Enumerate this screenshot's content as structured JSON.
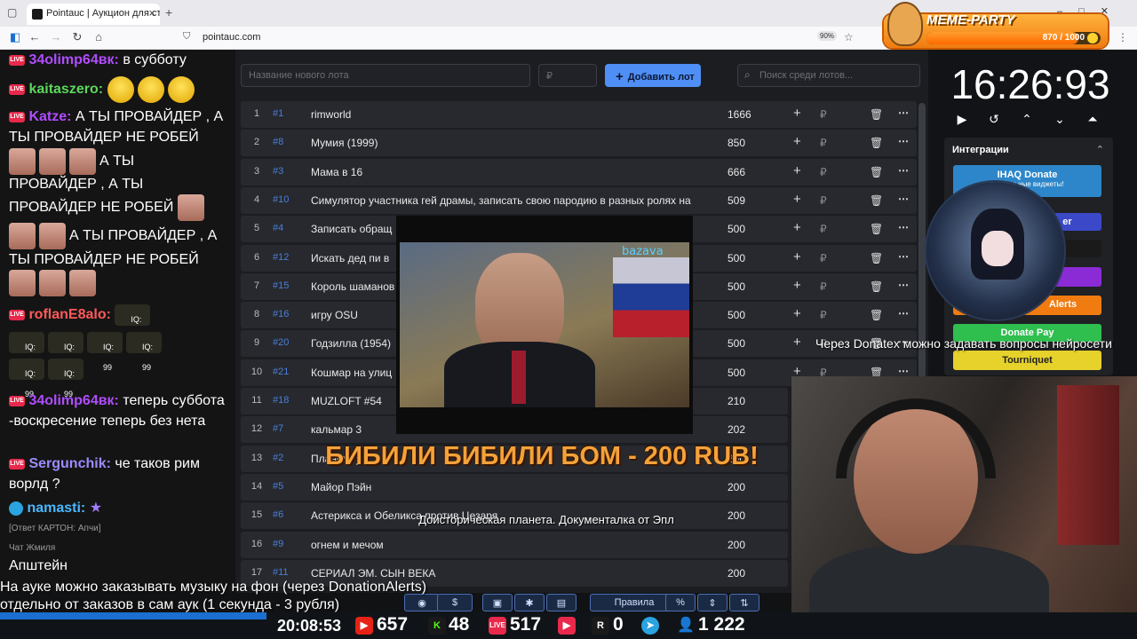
{
  "browser": {
    "tab_title": "Pointauc | Аукцион для стрим",
    "url": "pointauc.com",
    "zoom": "90%"
  },
  "meme": {
    "title": "MEME-PARTY",
    "score": "870 / 1000",
    "progress": 0.87
  },
  "chat": {
    "m1_nick": "34olimp64вк:",
    "m1_text": "в субботу",
    "m2_nick": "kaitaszero:",
    "m3_nick": "Katze:",
    "m3_text": "А ТЫ ПРОВАЙДЕР , А ТЫ ПРОВАЙДЕР НЕ РОБЕЙ",
    "m3_text2": "А ТЫ",
    "m3_text3": "ПРОВАЙДЕР , А ТЫ",
    "m3_text4": "ПРОВАЙДЕР НЕ РОБЕЙ",
    "m3_text5": "А ТЫ ПРОВАЙДЕР , А ТЫ ПРОВАЙДЕР НЕ РОБЕЙ",
    "m4_nick": "roflanE8alo:",
    "iq": "IQ: 99",
    "m5_nick": "34olimp64вк:",
    "m5_text": "теперь суббота -воскресение теперь без нета",
    "m6_nick": "Sergunchik:",
    "m6_text": "че таков рим ворлд ?",
    "m7_nick": "namasti:",
    "m7_star": "★",
    "m7_reply": "[Ответ КАРТОН: Апчи]",
    "m8_head": "Чат Жмиля",
    "m8_text": "Апштейн"
  },
  "auction": {
    "new_lot_placeholder": "Название нового лота",
    "amount_placeholder": "₽",
    "add_label": "Добавить лот",
    "search_placeholder": "Поиск среди лотов...",
    "rows": [
      {
        "i": "1",
        "id": "#1",
        "name": "rimworld",
        "amount": "1666"
      },
      {
        "i": "2",
        "id": "#8",
        "name": "Мумия (1999)",
        "amount": "850"
      },
      {
        "i": "3",
        "id": "#3",
        "name": "Мама в 16",
        "amount": "666"
      },
      {
        "i": "4",
        "id": "#10",
        "name": "Симулятор участника гей драмы, записать свою пародию в разных ролях на",
        "amount": "509"
      },
      {
        "i": "5",
        "id": "#4",
        "name": "Записать обращ",
        "amount": "500"
      },
      {
        "i": "6",
        "id": "#12",
        "name": "Искать дед пи в",
        "amount": "500"
      },
      {
        "i": "7",
        "id": "#15",
        "name": "Король шаманов",
        "amount": "500"
      },
      {
        "i": "8",
        "id": "#16",
        "name": "игру OSU",
        "amount": "500"
      },
      {
        "i": "9",
        "id": "#20",
        "name": "Годзилла (1954)",
        "amount": "500"
      },
      {
        "i": "10",
        "id": "#21",
        "name": "Кошмар на улиц",
        "amount": "500"
      },
      {
        "i": "11",
        "id": "#18",
        "name": "MUZLOFT #54",
        "amount": "210"
      },
      {
        "i": "12",
        "id": "#7",
        "name": "кальмар 3",
        "amount": "202"
      },
      {
        "i": "13",
        "id": "#2",
        "name": "Планета у",
        "amount": "200"
      },
      {
        "i": "14",
        "id": "#5",
        "name": "Майор Пэйн",
        "amount": "200"
      },
      {
        "i": "15",
        "id": "#6",
        "name": "Астерикса и Обеликса против Цезаря",
        "amount": "200"
      },
      {
        "i": "16",
        "id": "#9",
        "name": "огнем и мечом",
        "amount": "200"
      },
      {
        "i": "17",
        "id": "#11",
        "name": "СЕРИАЛ ЭМ. СЫН ВЕКА",
        "amount": "200"
      }
    ]
  },
  "video": {
    "watermark": "bazava"
  },
  "alert": {
    "headline": "БИБИЛИ БИБИЛИ БОМ - 200 RUB!",
    "message": "Доисторическая планета. Документалка от Эпл"
  },
  "timer": "16:26:93",
  "integrations": {
    "title": "Интеграции",
    "b1": "IHAQ Donate",
    "b1_sub": "Уникальные виджеты!",
    "b2": "er",
    "b3": "Alerts",
    "b4": "Donate Pay",
    "b5": "Tourniquet"
  },
  "donatex_text": "Через Donatex можно задавать вопросы нейросети",
  "toolbar": {
    "rules": "Правила"
  },
  "ticker": {
    "line1": "На ауке можно заказывать музыку на фон (через DonationAlerts)",
    "line2": "отдельно от заказов в сам аук (1 секунда - 3 рубля)"
  },
  "status": {
    "time": "20:08:53",
    "youtube": "657",
    "kick": "48",
    "vk": "517",
    "rutube": "0",
    "telegram": "",
    "viewers": "1 222"
  },
  "colors": {
    "accent": "#4f8ff5",
    "alert": "#f3a23b",
    "chat_nick_purple": "#b04cff",
    "chat_nick_green": "#5cd65c"
  }
}
